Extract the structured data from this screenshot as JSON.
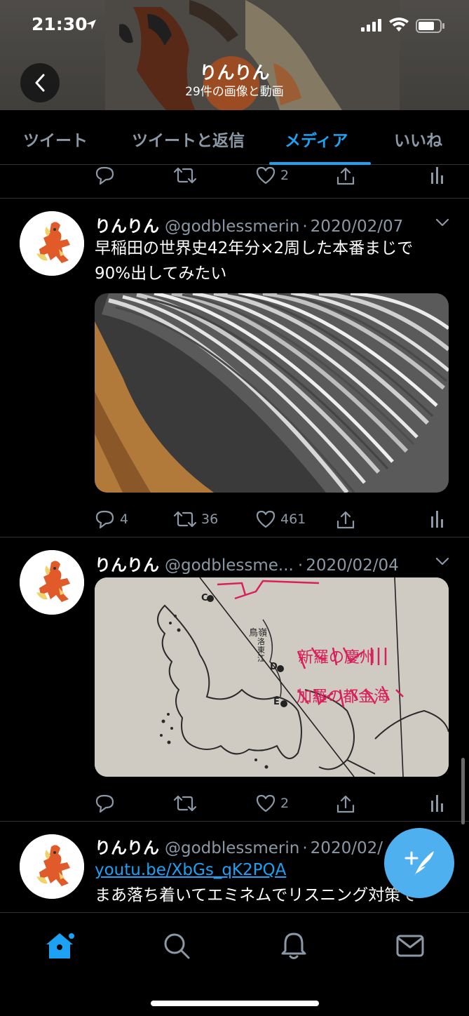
{
  "status_bar": {
    "time": "21:30"
  },
  "header": {
    "profile_name": "りんりん",
    "profile_subtitle": "29件の画像と動画"
  },
  "tabs": [
    {
      "label": "ツイート"
    },
    {
      "label": "ツイートと返信"
    },
    {
      "label": "メディア",
      "active": true
    },
    {
      "label": "いいね"
    }
  ],
  "tweets": [
    {
      "actions": {
        "reply": "",
        "retweet": "",
        "like": "2"
      }
    },
    {
      "name": "りんりん",
      "handle": "@godblessmerin",
      "date": "2020/02/07",
      "text_line1": "早稲田の世界史42年分×2周した本番まじで",
      "text_line2": "90%出してみたい",
      "actions": {
        "reply": "4",
        "retweet": "36",
        "like": "461"
      }
    },
    {
      "name": "りんりん",
      "handle": "@godblessme...",
      "date": "2020/02/04",
      "map_labels": {
        "c": "C",
        "d": "D",
        "e": "E",
        "place1": "鳥嶺",
        "river": "洛東江"
      },
      "annotations": [
        "新羅の慶州",
        "加羅の都金海"
      ],
      "actions": {
        "reply": "",
        "retweet": "",
        "like": "2"
      }
    },
    {
      "name": "りんりん",
      "handle": "@godblessmerin",
      "date": "2020/02/",
      "link": "youtu.be/XbGs_qK2PQA",
      "text_line1": "まあ落ち着いてエミネムでリスニング対策で"
    }
  ],
  "colors": {
    "accent": "#1da1f2",
    "muted": "#8b98a5",
    "background": "#000000",
    "divider": "#2f3336",
    "fab": "#4fb0f0"
  },
  "icons": {
    "back": "chevron-left-icon",
    "reply": "reply-icon",
    "retweet": "retweet-icon",
    "like": "heart-icon",
    "share": "share-icon",
    "analytics": "analytics-icon",
    "more": "chevron-down-icon",
    "compose": "compose-tweet-icon",
    "nav_home": "home-icon",
    "nav_search": "search-icon",
    "nav_notifications": "bell-icon",
    "nav_messages": "mail-icon"
  }
}
